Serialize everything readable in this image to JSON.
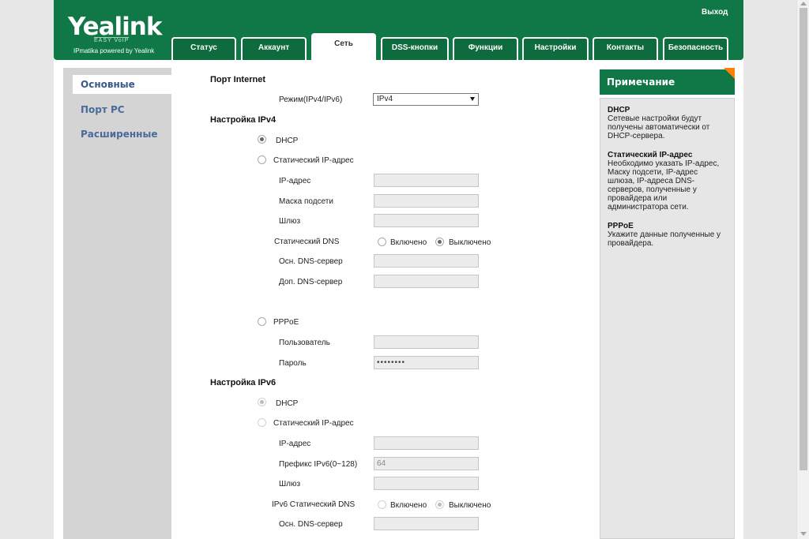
{
  "header": {
    "brand": "Yealink",
    "brand_sub": "EASY VoIP",
    "tagline": "IPmatika powered by Yealink",
    "logout": "Выход"
  },
  "tabs": [
    "Статус",
    "Аккаунт",
    "Сеть",
    "DSS-кнопки",
    "Функции",
    "Настройки",
    "Контакты",
    "Безопасность"
  ],
  "active_tab": "Сеть",
  "sidebar": {
    "items": [
      "Основные",
      "Порт PC",
      "Расширенные"
    ],
    "active": "Основные"
  },
  "form": {
    "internet_port": {
      "title": "Порт Internet",
      "mode_label": "Режим(IPv4/IPv6)",
      "mode_value": "IPv4"
    },
    "ipv4": {
      "title": "Настройка IPv4",
      "dhcp": "DHCP",
      "static": "Статический IP-адрес",
      "ip": "IP-адрес",
      "mask": "Маска подсети",
      "gateway": "Шлюз",
      "static_dns": "Статический DNS",
      "on": "Включено",
      "off": "Выключено",
      "dns1": "Осн. DNS-сервер",
      "dns2": "Доп. DNS-сервер",
      "pppoe": "PPPoE",
      "user": "Пользователь",
      "password": "Пароль",
      "password_value": "••••••••"
    },
    "ipv6": {
      "title": "Настройка IPv6",
      "dhcp": "DHCP",
      "static": "Статический IP-адрес",
      "ip": "IP-адрес",
      "prefix": "Префикс IPv6(0~128)",
      "prefix_value": "64",
      "gateway": "Шлюз",
      "static_dns": "IPv6 Статический DNS",
      "on": "Включено",
      "off": "Выключено",
      "dns1": "Осн. DNS-сервер"
    }
  },
  "note": {
    "title": "Примечание",
    "sections": [
      {
        "heading": "DHCP",
        "text": "Сетевые настройки будут получены автоматически от DHCP-сервера."
      },
      {
        "heading": "Статический IP-адрес",
        "text": "Необходимо указать IP-адрес, Маску подсети, IP-адрес шлюза, IP-адреса DNS-серверов, полученные у провайдера или администратора сети."
      },
      {
        "heading": "PPPoE",
        "text": "Укажите данные полученные у провайдера."
      }
    ]
  },
  "colors": {
    "brand_green": "#0f7846",
    "accent_orange": "#ff7f00",
    "sidebar_text": "#4a6a9a"
  }
}
